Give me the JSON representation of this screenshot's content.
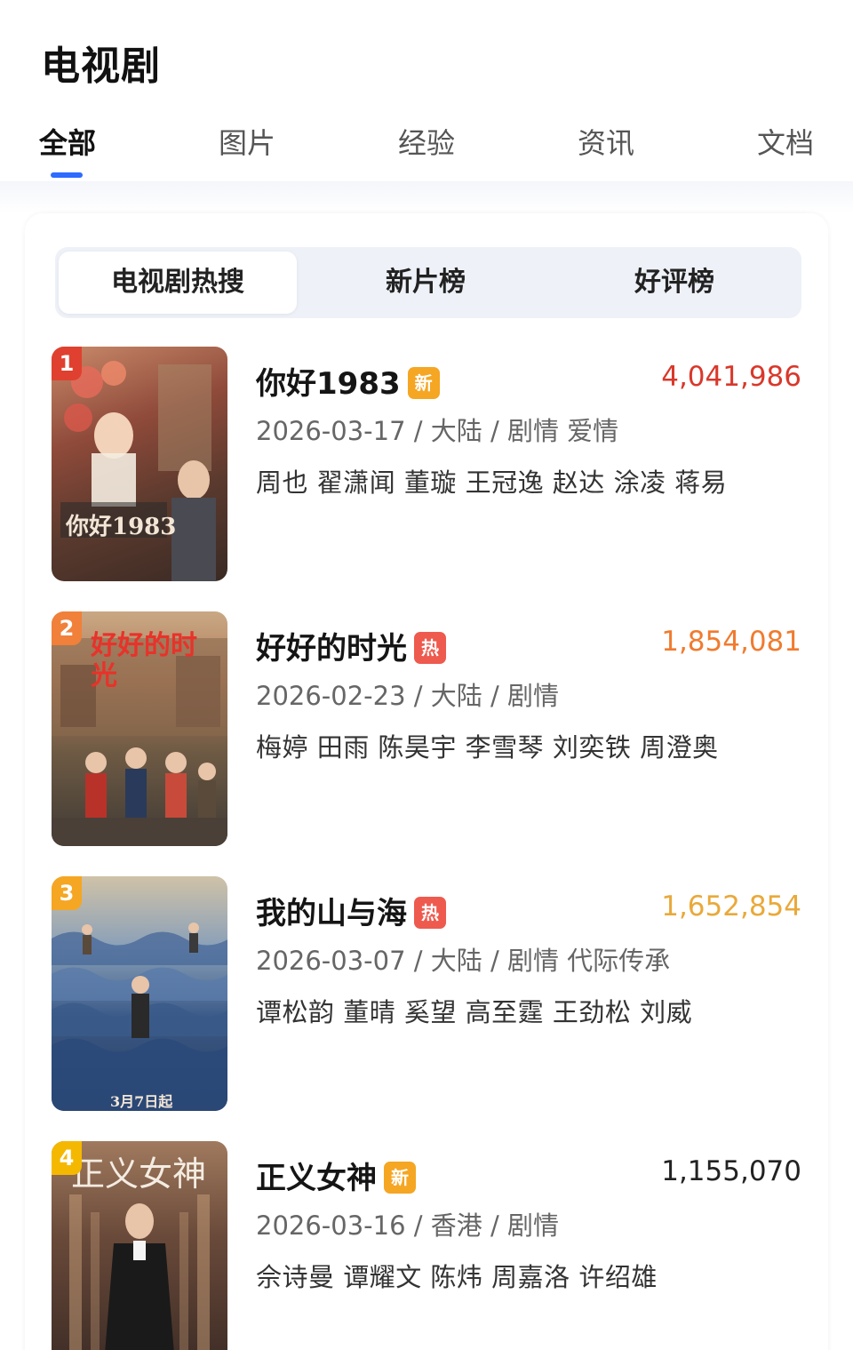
{
  "page": {
    "title": "电视剧"
  },
  "tabs": [
    {
      "label": "全部",
      "active": true
    },
    {
      "label": "图片",
      "active": false
    },
    {
      "label": "经验",
      "active": false
    },
    {
      "label": "资讯",
      "active": false
    },
    {
      "label": "文档",
      "active": false
    }
  ],
  "subtabs": [
    {
      "label": "电视剧热搜",
      "active": true
    },
    {
      "label": "新片榜",
      "active": false
    },
    {
      "label": "好评榜",
      "active": false
    }
  ],
  "list": [
    {
      "rank": "1",
      "title": "你好1983",
      "badge": "新",
      "views": "4,041,986",
      "meta": "2026-03-17 / 大陆 / 剧情 爱情",
      "cast": "周也 翟潇闻 董璇 王冠逸 赵达 涂凌 蒋易",
      "poster_text": "你好1983"
    },
    {
      "rank": "2",
      "title": "好好的时光",
      "badge": "热",
      "views": "1,854,081",
      "meta": "2026-02-23 / 大陆 / 剧情",
      "cast": "梅婷 田雨 陈昊宇 李雪琴 刘奕铁 周澄奥",
      "poster_text": "好好的时光"
    },
    {
      "rank": "3",
      "title": "我的山与海",
      "badge": "热",
      "views": "1,652,854",
      "meta": "2026-03-07 / 大陆 / 剧情 代际传承",
      "cast": "谭松韵 董晴 奚望 高至霆 王劲松 刘威",
      "poster_text": "3月7日起"
    },
    {
      "rank": "4",
      "title": "正义女神",
      "badge": "新",
      "views": "1,155,070",
      "meta": "2026-03-16 / 香港 / 剧情",
      "cast": "佘诗曼 谭耀文 陈炜 周嘉洛 许绍雄",
      "poster_text": "正义女神"
    }
  ],
  "colors": {
    "accent": "#2e6bff",
    "rank1": "#e0402f",
    "rank2": "#f0803a",
    "rank3": "#f5a623",
    "rank4": "#f5b800",
    "badge_new": "#f5a623",
    "badge_hot": "#ee5a4e",
    "views1": "#d9382b",
    "views2": "#f07b2f",
    "views3": "#e9a93a",
    "views4": "#222222"
  }
}
